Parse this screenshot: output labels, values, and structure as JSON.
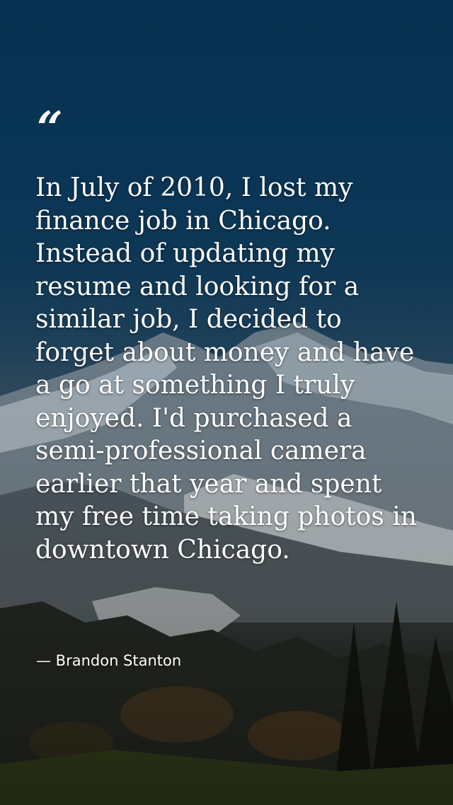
{
  "quote": {
    "mark": "“",
    "text": "In July of 2010, I lost my finance job in Chicago. Instead of updating my resume and looking for a similar job, I decided to forget about money and have a go at something I truly enjoyed. I'd purchased a semi-professional camera earlier that year and spent my free time taking photos in downtown Chicago.",
    "author": "— Brandon Stanton"
  },
  "colors": {
    "sky": "#0b3d60",
    "text": "#ffffff"
  }
}
